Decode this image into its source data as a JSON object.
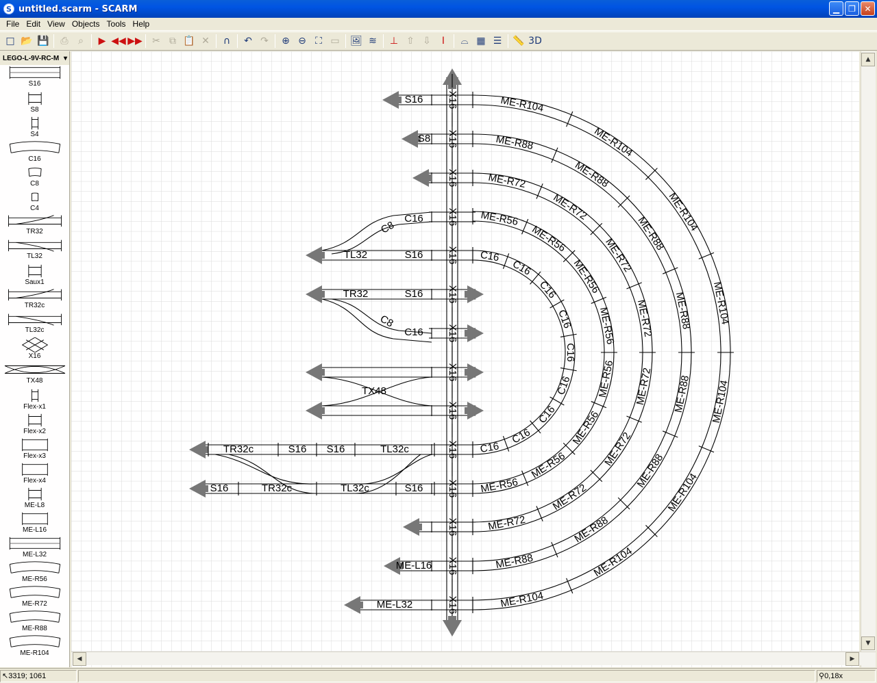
{
  "window": {
    "title": "untitled.scarm - SCARM",
    "app_icon": "S"
  },
  "menu": [
    "File",
    "Edit",
    "View",
    "Objects",
    "Tools",
    "Help"
  ],
  "toolbar": {
    "buttons": [
      {
        "icon": "new-icon",
        "glyph": "□",
        "disabled": false
      },
      {
        "icon": "open-icon",
        "glyph": "📂",
        "disabled": false
      },
      {
        "icon": "save-icon",
        "glyph": "💾",
        "disabled": false
      },
      {
        "icon": "sep"
      },
      {
        "icon": "print-icon",
        "glyph": "⎙",
        "disabled": true
      },
      {
        "icon": "print-preview-icon",
        "glyph": "⌕",
        "disabled": true
      },
      {
        "icon": "sep"
      },
      {
        "icon": "play-icon",
        "glyph": "▶",
        "red": true
      },
      {
        "icon": "rewind-icon",
        "glyph": "◀◀",
        "red": true
      },
      {
        "icon": "fast-forward-icon",
        "glyph": "▶▶",
        "red": true
      },
      {
        "icon": "sep"
      },
      {
        "icon": "cut-icon",
        "glyph": "✂",
        "disabled": true
      },
      {
        "icon": "copy-icon",
        "glyph": "⧉",
        "disabled": true
      },
      {
        "icon": "paste-icon",
        "glyph": "📋",
        "disabled": true
      },
      {
        "icon": "delete-icon",
        "glyph": "✕",
        "disabled": true
      },
      {
        "icon": "sep"
      },
      {
        "icon": "magnet-icon",
        "glyph": "∩",
        "disabled": false
      },
      {
        "icon": "sep"
      },
      {
        "icon": "undo-icon",
        "glyph": "↶",
        "disabled": false
      },
      {
        "icon": "redo-icon",
        "glyph": "↷",
        "disabled": true
      },
      {
        "icon": "sep"
      },
      {
        "icon": "zoom-in-icon",
        "glyph": "⊕",
        "disabled": false
      },
      {
        "icon": "zoom-out-icon",
        "glyph": "⊖",
        "disabled": false
      },
      {
        "icon": "zoom-fit-icon",
        "glyph": "⛶",
        "disabled": false
      },
      {
        "icon": "zoom-box-icon",
        "glyph": "▭",
        "disabled": true
      },
      {
        "icon": "sep"
      },
      {
        "icon": "background-image-icon",
        "glyph": "🖼",
        "disabled": false
      },
      {
        "icon": "layers-icon",
        "glyph": "≋",
        "disabled": false
      },
      {
        "icon": "sep"
      },
      {
        "icon": "track-tool-icon",
        "glyph": "⊥",
        "red": true
      },
      {
        "icon": "height-up-icon",
        "glyph": "⇧",
        "disabled": true
      },
      {
        "icon": "height-down-icon",
        "glyph": "⇩",
        "disabled": true
      },
      {
        "icon": "insulator-icon",
        "glyph": "Ⅰ",
        "red": true
      },
      {
        "icon": "sep"
      },
      {
        "icon": "bridge-icon",
        "glyph": "⌓",
        "disabled": false
      },
      {
        "icon": "tunnel-icon",
        "glyph": "▦",
        "disabled": false
      },
      {
        "icon": "roadbed-icon",
        "glyph": "☰",
        "disabled": false
      },
      {
        "icon": "sep"
      },
      {
        "icon": "measure-icon",
        "glyph": "📏",
        "disabled": false
      },
      {
        "icon": "3d-view-icon",
        "glyph": "3D",
        "disabled": false
      }
    ]
  },
  "library": {
    "selected": "LEGO-L-9V-RC-M",
    "parts": [
      {
        "label": "S16",
        "kind": "straight-long"
      },
      {
        "label": "S8",
        "kind": "straight-short"
      },
      {
        "label": "S4",
        "kind": "straight-tiny"
      },
      {
        "label": "C16",
        "kind": "curve"
      },
      {
        "label": "C8",
        "kind": "curve-short"
      },
      {
        "label": "C4",
        "kind": "curve-tiny"
      },
      {
        "label": "TR32",
        "kind": "switch-right"
      },
      {
        "label": "TL32",
        "kind": "switch-left"
      },
      {
        "label": "Saux1",
        "kind": "straight-short"
      },
      {
        "label": "TR32c",
        "kind": "switch-right"
      },
      {
        "label": "TL32c",
        "kind": "switch-left"
      },
      {
        "label": "X16",
        "kind": "crossing"
      },
      {
        "label": "TX48",
        "kind": "double-crossing"
      },
      {
        "label": "Flex-x1",
        "kind": "straight-tiny"
      },
      {
        "label": "Flex-x2",
        "kind": "straight-short"
      },
      {
        "label": "Flex-x3",
        "kind": "straight-mid"
      },
      {
        "label": "Flex-x4",
        "kind": "straight-mid"
      },
      {
        "label": "ME-L8",
        "kind": "straight-short"
      },
      {
        "label": "ME-L16",
        "kind": "straight-mid"
      },
      {
        "label": "ME-L32",
        "kind": "straight-long"
      },
      {
        "label": "ME-R56",
        "kind": "curve"
      },
      {
        "label": "ME-R72",
        "kind": "curve"
      },
      {
        "label": "ME-R88",
        "kind": "curve"
      },
      {
        "label": "ME-R104",
        "kind": "curve"
      }
    ]
  },
  "layout": {
    "crossing_labels": [
      "X16",
      "X16",
      "X16",
      "X16",
      "X16",
      "X16",
      "X16",
      "X16",
      "X16",
      "X16",
      "X16",
      "X16",
      "X16",
      "X16"
    ],
    "left_straights": [
      "S16",
      "S8",
      "",
      "",
      "S16",
      "S16",
      "",
      "",
      "",
      "",
      "S16",
      "S16",
      "S16",
      "S16"
    ],
    "arc_labels": {
      "r104": [
        "ME-R104",
        "ME-R104",
        "ME-R104",
        "ME-R104",
        "ME-R104",
        "ME-R104",
        "ME-R104",
        "ME-R104"
      ],
      "r88": [
        "ME-R88",
        "ME-R88",
        "ME-R88",
        "ME-R88",
        "ME-R88",
        "ME-R88",
        "ME-R88",
        "ME-R88"
      ],
      "r72": [
        "ME-R72",
        "ME-R72",
        "ME-R72",
        "ME-R72",
        "ME-R72",
        "ME-R72",
        "ME-R72",
        "ME-R72"
      ],
      "r56": [
        "ME-R56",
        "ME-R56",
        "ME-R56",
        "ME-R56",
        "ME-R56",
        "ME-R56",
        "ME-R56",
        "ME-R56"
      ],
      "c16": [
        "C16",
        "C16",
        "C16",
        "C16",
        "C16",
        "C16",
        "C16",
        "C16",
        "C16"
      ]
    },
    "misc_labels": {
      "c8_top": "C8",
      "c16_top": "C16",
      "tl32": "TL32",
      "tr32": "TR32",
      "c8_mid": "C8",
      "c16_mid": "C16",
      "tx48": "TX48",
      "tr32c_a": "TR32c",
      "s16_a": "S16",
      "s16_b": "S16",
      "tl32c_a": "TL32c",
      "s16_c": "S16",
      "tr32c_b": "TR32c",
      "tl32c_b": "TL32c",
      "s16_d": "S16",
      "me_l16": "ME-L16",
      "me_l32": "ME-L32"
    }
  },
  "status": {
    "coords": "3319; 1061",
    "zoom": "0,18x"
  }
}
